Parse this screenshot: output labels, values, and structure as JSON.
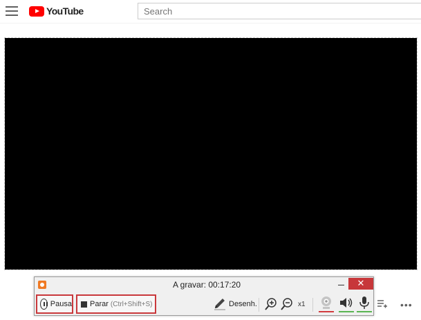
{
  "youtube": {
    "logo_text": "YouTube",
    "search_placeholder": "Search"
  },
  "recorder": {
    "status_label": "A gravar:",
    "elapsed": "00:17:20",
    "close_glyph": "✕",
    "pause_label": "Pausa",
    "stop_label": "Parar",
    "stop_shortcut": "(Ctrl+Shift+S)",
    "draw_label": "Desenh.",
    "zoom_level": "x1",
    "indicator_colors": {
      "webcam": "#d23b3e",
      "speaker": "#5ab552",
      "mic": "#5ab552"
    },
    "icons": [
      "app-icon",
      "pause-icon",
      "stop-icon",
      "pencil-icon",
      "zoom-in-icon",
      "zoom-out-icon",
      "webcam-icon",
      "speaker-icon",
      "microphone-icon"
    ]
  },
  "player": {
    "background": "#000000"
  },
  "youtube_controls": {
    "more_glyph": "•••"
  }
}
